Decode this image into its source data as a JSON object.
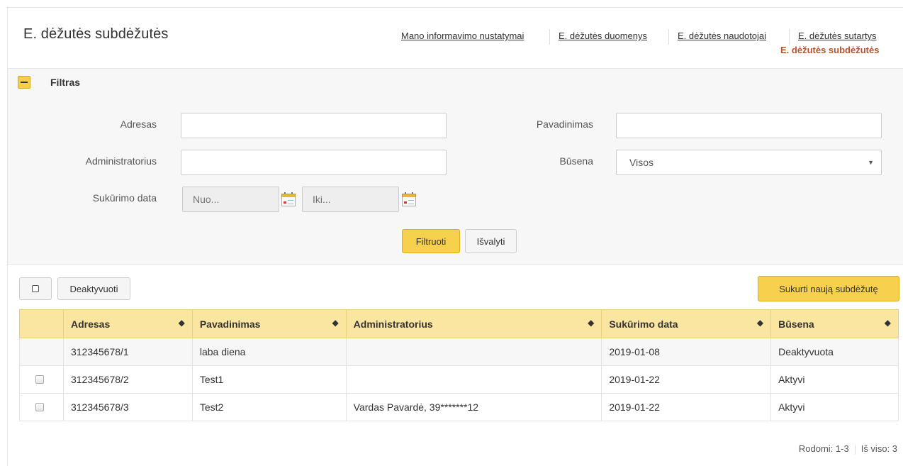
{
  "page": {
    "title": "E. dėžutės subdėžutės"
  },
  "nav": {
    "links": [
      "Mano informavimo nustatymai",
      "E. dėžutės duomenys",
      "E. dėžutės naudotojai",
      "E. dėžutės sutartys"
    ],
    "active": "E. dėžutės subdėžutės"
  },
  "filter": {
    "title": "Filtras",
    "address_label": "Adresas",
    "address_value": "",
    "name_label": "Pavadinimas",
    "name_value": "",
    "admin_label": "Administratorius",
    "admin_value": "",
    "status_label": "Būsena",
    "status_value": "Visos",
    "created_label": "Sukūrimo data",
    "from_placeholder": "Nuo...",
    "to_placeholder": "Iki...",
    "filter_button": "Filtruoti",
    "clear_button": "Išvalyti"
  },
  "toolbar": {
    "deactivate_button": "Deaktyvuoti",
    "create_button": "Sukurti naują subdėžutę"
  },
  "table": {
    "columns": [
      "Adresas",
      "Pavadinimas",
      "Administratorius",
      "Sukūrimo data",
      "Būsena"
    ],
    "rows": [
      {
        "address": "312345678/1",
        "name": "laba diena",
        "admin": "",
        "created": "2019-01-08",
        "status": "Deaktyvuota",
        "selectable": false
      },
      {
        "address": "312345678/2",
        "name": "Test1",
        "admin": "",
        "created": "2019-01-22",
        "status": "Aktyvi",
        "selectable": true
      },
      {
        "address": "312345678/3",
        "name": "Test2",
        "admin": "Vardas Pavardė, 39*******12",
        "created": "2019-01-22",
        "status": "Aktyvi",
        "selectable": true
      }
    ]
  },
  "pager": {
    "shown": "Rodomi: 1-3",
    "total": "Iš viso: 3"
  },
  "icons": {
    "toggle": "minus-icon",
    "calendar": "calendar-icon",
    "sort": "sort-icon",
    "select_caret": "caret-down-icon",
    "checkbox": "checkbox-icon"
  },
  "colors": {
    "accent": "#f7d04d",
    "table_header": "#fbe6a1",
    "active_link": "#b5532a"
  }
}
